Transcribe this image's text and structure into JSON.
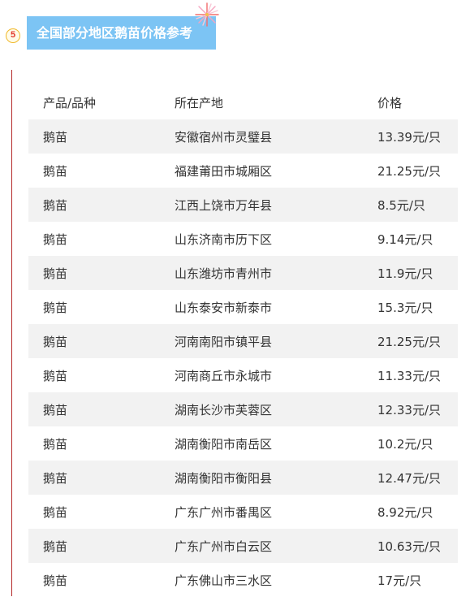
{
  "section": {
    "number": "5",
    "title": "全国部分地区鹅苗价格参考"
  },
  "table": {
    "headers": [
      "产品/品种",
      "所在产地",
      "价格"
    ],
    "rows": [
      [
        "鹅苗",
        "安徽宿州市灵璧县",
        "13.39元/只"
      ],
      [
        "鹅苗",
        "福建莆田市城厢区",
        "21.25元/只"
      ],
      [
        "鹅苗",
        "江西上饶市万年县",
        "8.5元/只"
      ],
      [
        "鹅苗",
        "山东济南市历下区",
        "9.14元/只"
      ],
      [
        "鹅苗",
        "山东潍坊市青州市",
        "11.9元/只"
      ],
      [
        "鹅苗",
        "山东泰安市新泰市",
        "15.3元/只"
      ],
      [
        "鹅苗",
        "河南南阳市镇平县",
        "21.25元/只"
      ],
      [
        "鹅苗",
        "河南商丘市永城市",
        "11.33元/只"
      ],
      [
        "鹅苗",
        "湖南长沙市芙蓉区",
        "12.33元/只"
      ],
      [
        "鹅苗",
        "湖南衡阳市南岳区",
        "10.2元/只"
      ],
      [
        "鹅苗",
        "湖南衡阳市衡阳县",
        "12.47元/只"
      ],
      [
        "鹅苗",
        "广东广州市番禺区",
        "8.92元/只"
      ],
      [
        "鹅苗",
        "广东广州市白云区",
        "10.63元/只"
      ],
      [
        "鹅苗",
        "广东佛山市三水区",
        "17元/只"
      ]
    ]
  },
  "colors": {
    "title_bg": "#7cc4f4",
    "accent_line": "#b42a2a",
    "row_shade": "#f2f2f2"
  }
}
